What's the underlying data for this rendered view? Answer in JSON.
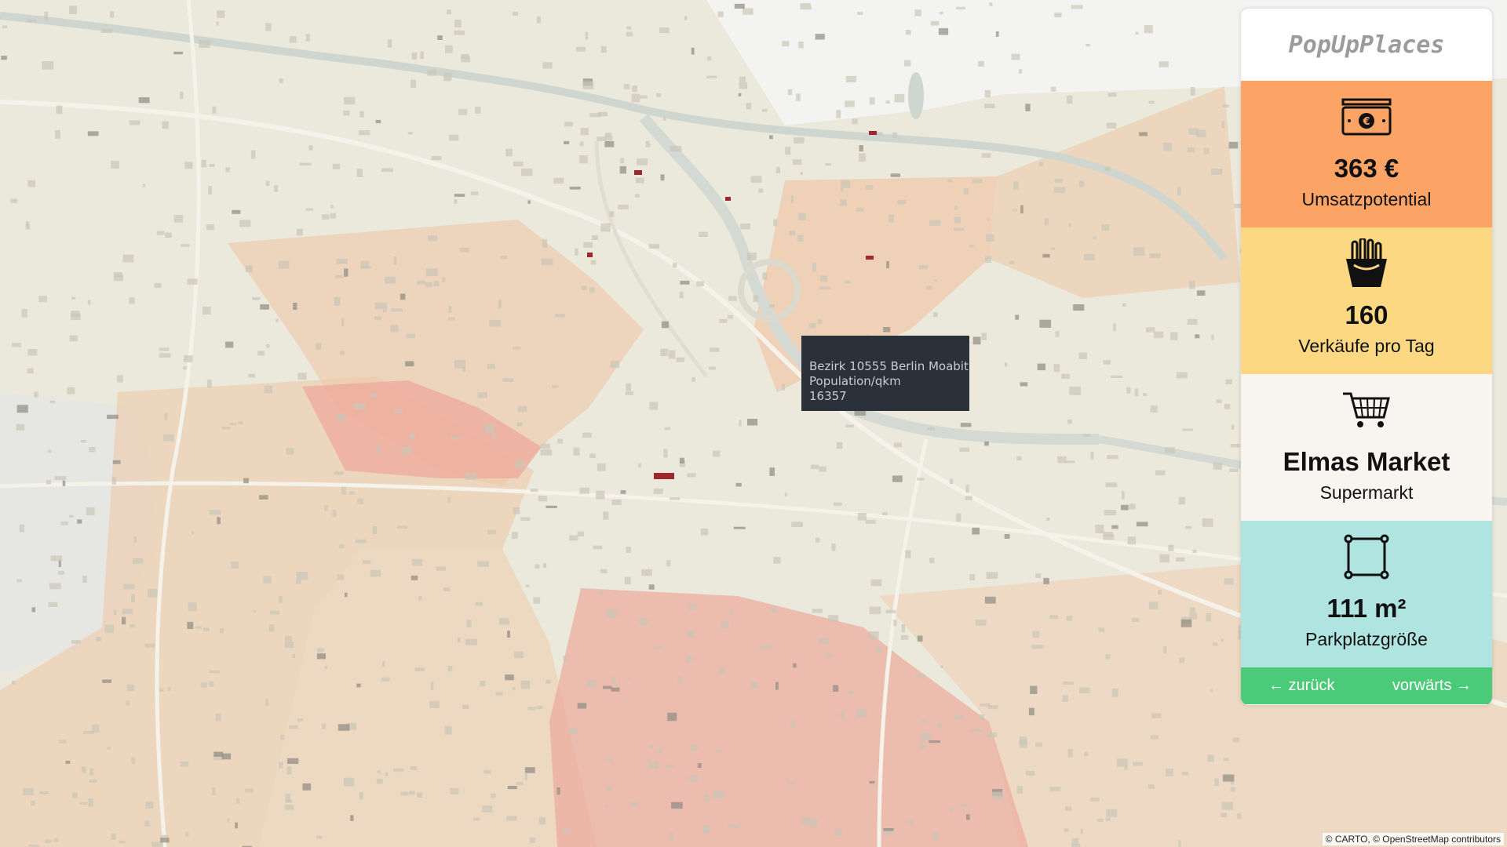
{
  "map": {
    "style": "light",
    "colors": {
      "base": "#ebe8dc",
      "district_orange": "#efc7a6",
      "district_red": "#eda99b",
      "water": "#cfd6cf",
      "building": "#b7b3a6",
      "highlight_building": "#a0272b"
    },
    "attribution": "© CARTO, © OpenStreetMap contributors"
  },
  "tooltip": {
    "line1": "Bezirk 10555 Berlin Moabit",
    "line2": "Population/qkm",
    "line3": "16357"
  },
  "panel": {
    "logo": "PopUpPlaces",
    "stats": [
      {
        "icon": "money-icon",
        "value": "363 €",
        "label": "Umsatzpotential",
        "color": "#fba466"
      },
      {
        "icon": "fries-icon",
        "value": "160",
        "label": "Verkäufe pro Tag",
        "color": "#fcd882"
      },
      {
        "icon": "cart-icon",
        "value": "Elmas Market",
        "label": "Supermarkt",
        "color": "#f8f4ef"
      },
      {
        "icon": "square-icon",
        "value": "111 m²",
        "label": "Parkplatzgröße",
        "color": "#b0e4e1"
      }
    ],
    "nav": {
      "back": "← zurück",
      "forward": "vorwärts →",
      "color": "#4bca7a"
    }
  }
}
